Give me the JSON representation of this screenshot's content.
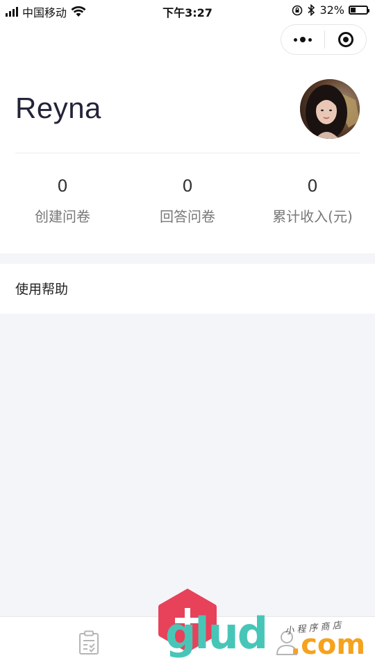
{
  "status_bar": {
    "carrier": "中国移动",
    "time": "下午3:27",
    "battery": "32%",
    "battery_level": 0.32
  },
  "capsule": {
    "more_icon": "more-dots-icon",
    "close_icon": "target-icon"
  },
  "profile": {
    "name": "Reyna",
    "avatar_icon": "user-avatar"
  },
  "stats": [
    {
      "value": "0",
      "label": "创建问卷"
    },
    {
      "value": "0",
      "label": "回答问卷"
    },
    {
      "value": "0",
      "label": "累计收入(元)"
    }
  ],
  "menu": {
    "help_label": "使用帮助"
  },
  "tabbar": {
    "survey_icon": "clipboard-icon",
    "add_icon": "plus-icon",
    "user_icon": "user-icon"
  },
  "watermark": {
    "brand": "glud",
    "domain": ".com",
    "tagline": "小 程 序 商 店"
  },
  "colors": {
    "fab": "#e8415a",
    "page_bg": "#f4f5f8",
    "watermark_green": "#47c6b8",
    "watermark_orange": "#f5a21d"
  }
}
